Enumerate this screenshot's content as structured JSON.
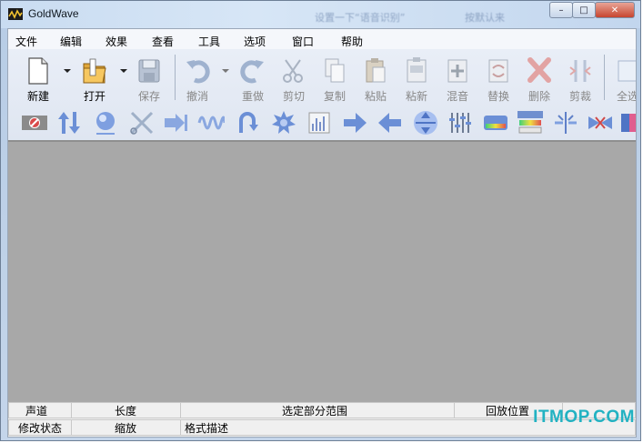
{
  "window": {
    "title": "GoldWave",
    "minimize_glyph": "–",
    "restore_glyph": "□",
    "close_glyph": "✕"
  },
  "background_text": {
    "left": "设置一下“语音识别”",
    "right": "按默认来"
  },
  "menu": {
    "items": [
      "文件",
      "编辑",
      "效果",
      "查看",
      "工具",
      "选项",
      "窗口",
      "帮助"
    ]
  },
  "toolbar": {
    "tools": [
      {
        "label": "新建",
        "icon": "new-file-icon",
        "enabled": true
      },
      {
        "label": "打开",
        "icon": "open-folder-icon",
        "enabled": true
      },
      {
        "label": "保存",
        "icon": "save-disk-icon",
        "enabled": false
      },
      {
        "label": "撤消",
        "icon": "undo-icon",
        "enabled": false
      },
      {
        "label": "重做",
        "icon": "redo-icon",
        "enabled": false
      },
      {
        "label": "剪切",
        "icon": "scissors-icon",
        "enabled": false
      },
      {
        "label": "复制",
        "icon": "copy-icon",
        "enabled": false
      },
      {
        "label": "粘贴",
        "icon": "paste-icon",
        "enabled": false
      },
      {
        "label": "粘新",
        "icon": "paste-new-icon",
        "enabled": false
      },
      {
        "label": "混音",
        "icon": "mix-icon",
        "enabled": false
      },
      {
        "label": "替换",
        "icon": "replace-icon",
        "enabled": false
      },
      {
        "label": "删除",
        "icon": "delete-x-icon",
        "enabled": false
      },
      {
        "label": "剪裁",
        "icon": "trim-icon",
        "enabled": false
      },
      {
        "label": "全选",
        "icon": "select-all-icon",
        "enabled": false
      }
    ],
    "effects_row": [
      "stop-sign-icon",
      "up-down-arrows-icon",
      "sphere-icon",
      "cut-x-icon",
      "arrow-join-icon",
      "waveform-icon",
      "loop-back-icon",
      "gear-burst-icon",
      "bar-graph-icon",
      "right-arrow-icon",
      "left-arrow-icon",
      "compress-icon",
      "equalizer-sliders-icon",
      "spectrum-bar-icon",
      "effect-preset-icon",
      "splitter-icon",
      "bowtie-icon",
      "color-grid-icon"
    ]
  },
  "statusbar": {
    "row1": [
      "声道",
      "长度",
      "选定部分范围",
      "回放位置"
    ],
    "row2": [
      "修改状态",
      "缩放",
      "格式描述"
    ]
  },
  "watermark": "ITMOP.COM",
  "colors": {
    "accent_blue": "#6b8fd6",
    "disabled_gray": "#9aa3ad",
    "canvas_gray": "#a8a8a8",
    "watermark_teal": "#22b2c2"
  }
}
